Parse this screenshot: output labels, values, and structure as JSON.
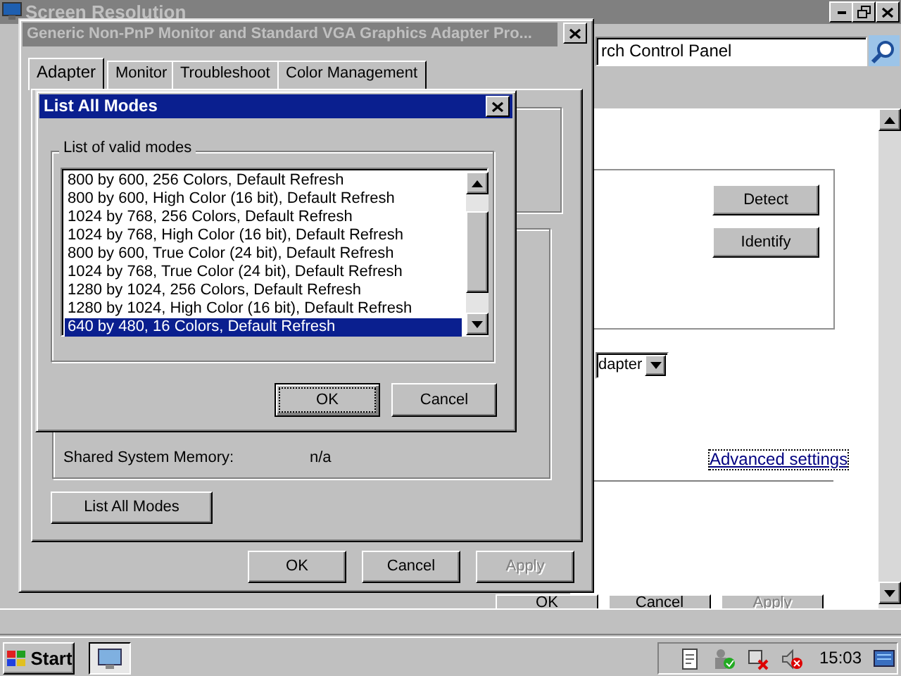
{
  "background_window": {
    "title": "Screen Resolution",
    "search": {
      "value": "rch Control Panel"
    },
    "side_buttons": [
      {
        "label": "Detect"
      },
      {
        "label": "Identify"
      }
    ],
    "dropdown": {
      "value": "dapter"
    },
    "link": "Advanced settings",
    "footer_buttons": [
      {
        "label": "OK",
        "disabled": false
      },
      {
        "label": "Cancel",
        "disabled": false
      },
      {
        "label": "Apply",
        "disabled": true
      }
    ]
  },
  "properties_dialog": {
    "title": "Generic Non-PnP Monitor and Standard VGA Graphics Adapter Pro...",
    "tabs": [
      {
        "label": "Adapter",
        "selected": true
      },
      {
        "label": "Monitor",
        "selected": false
      },
      {
        "label": "Troubleshoot",
        "selected": false
      },
      {
        "label": "Color Management",
        "selected": false
      }
    ],
    "info_rows": [
      {
        "label": "Shared System Memory:",
        "value": "n/a"
      }
    ],
    "list_button": "List All Modes",
    "buttons": [
      {
        "label": "OK",
        "disabled": false
      },
      {
        "label": "Cancel",
        "disabled": false
      },
      {
        "label": "Apply",
        "disabled": true
      }
    ]
  },
  "modes_dialog": {
    "title": "List All Modes",
    "group_label": "List of valid modes",
    "modes": [
      {
        "label": "800 by 600, 256 Colors, Default Refresh",
        "selected": false
      },
      {
        "label": "800 by 600, High Color (16 bit), Default Refresh",
        "selected": false
      },
      {
        "label": "1024 by 768, 256 Colors, Default Refresh",
        "selected": false
      },
      {
        "label": "1024 by 768, High Color (16 bit), Default Refresh",
        "selected": false
      },
      {
        "label": "800 by 600, True Color (24 bit), Default Refresh",
        "selected": false
      },
      {
        "label": "1024 by 768, True Color (24 bit), Default Refresh",
        "selected": false
      },
      {
        "label": "1280 by 1024, 256 Colors, Default Refresh",
        "selected": false
      },
      {
        "label": "1280 by 1024, High Color (16 bit), Default Refresh",
        "selected": false
      },
      {
        "label": "640 by 480, 16 Colors, Default Refresh",
        "selected": true
      }
    ],
    "buttons": [
      {
        "label": "OK",
        "focused": true
      },
      {
        "label": "Cancel",
        "focused": false
      }
    ]
  },
  "taskbar": {
    "start": "Start",
    "clock": "15:03"
  }
}
